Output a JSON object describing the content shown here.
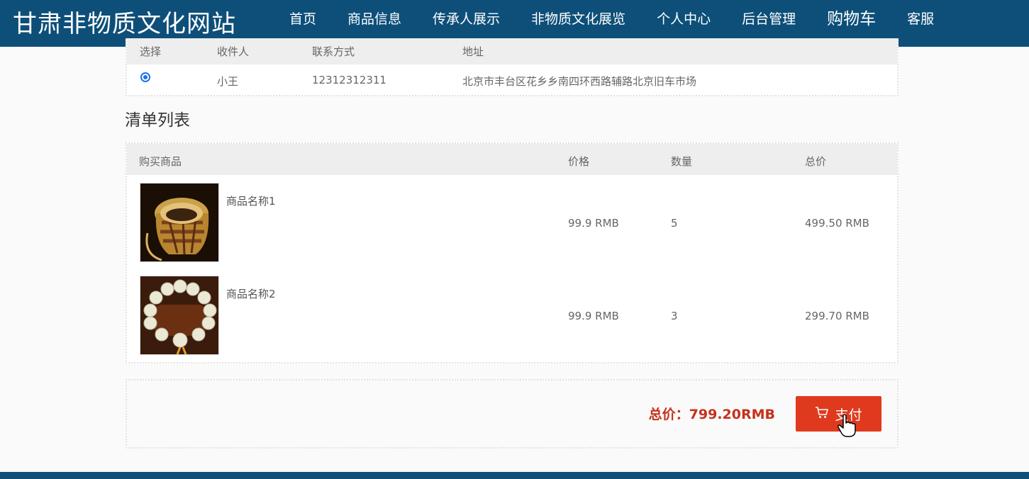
{
  "site": {
    "title": "甘肃非物质文化网站"
  },
  "nav": {
    "items": [
      {
        "label": "首页"
      },
      {
        "label": "商品信息"
      },
      {
        "label": "传承人展示"
      },
      {
        "label": "非物质文化展览"
      },
      {
        "label": "个人中心"
      },
      {
        "label": "后台管理"
      },
      {
        "label": "购物车",
        "active": true
      },
      {
        "label": "客服"
      }
    ]
  },
  "address": {
    "headers": {
      "select": "选择",
      "receiver": "收件人",
      "phone": "联系方式",
      "address": "地址"
    },
    "rows": [
      {
        "selected": true,
        "receiver": "小王",
        "phone": "12312312311",
        "address": "北京市丰台区花乡乡南四环西路辅路北京旧车市场"
      }
    ]
  },
  "list": {
    "title": "清单列表",
    "headers": {
      "product": "购买商品",
      "price": "价格",
      "quantity": "数量",
      "subtotal": "总价"
    },
    "rows": [
      {
        "name": "商品名称1",
        "price": "99.9 RMB",
        "quantity": "5",
        "subtotal": "499.50 RMB",
        "image_icon": "bamboo-basket-image"
      },
      {
        "name": "商品名称2",
        "price": "99.9 RMB",
        "quantity": "3",
        "subtotal": "299.70 RMB",
        "image_icon": "bead-bracelet-image"
      }
    ]
  },
  "checkout": {
    "total_label": "总价：799.20RMB",
    "pay_label": "支付",
    "pay_icon": "cart-icon"
  },
  "colors": {
    "header_bg": "#0d4f79",
    "pay_button": "#e03a1e",
    "total_text": "#c4321c",
    "radio": "#1a73e8"
  }
}
